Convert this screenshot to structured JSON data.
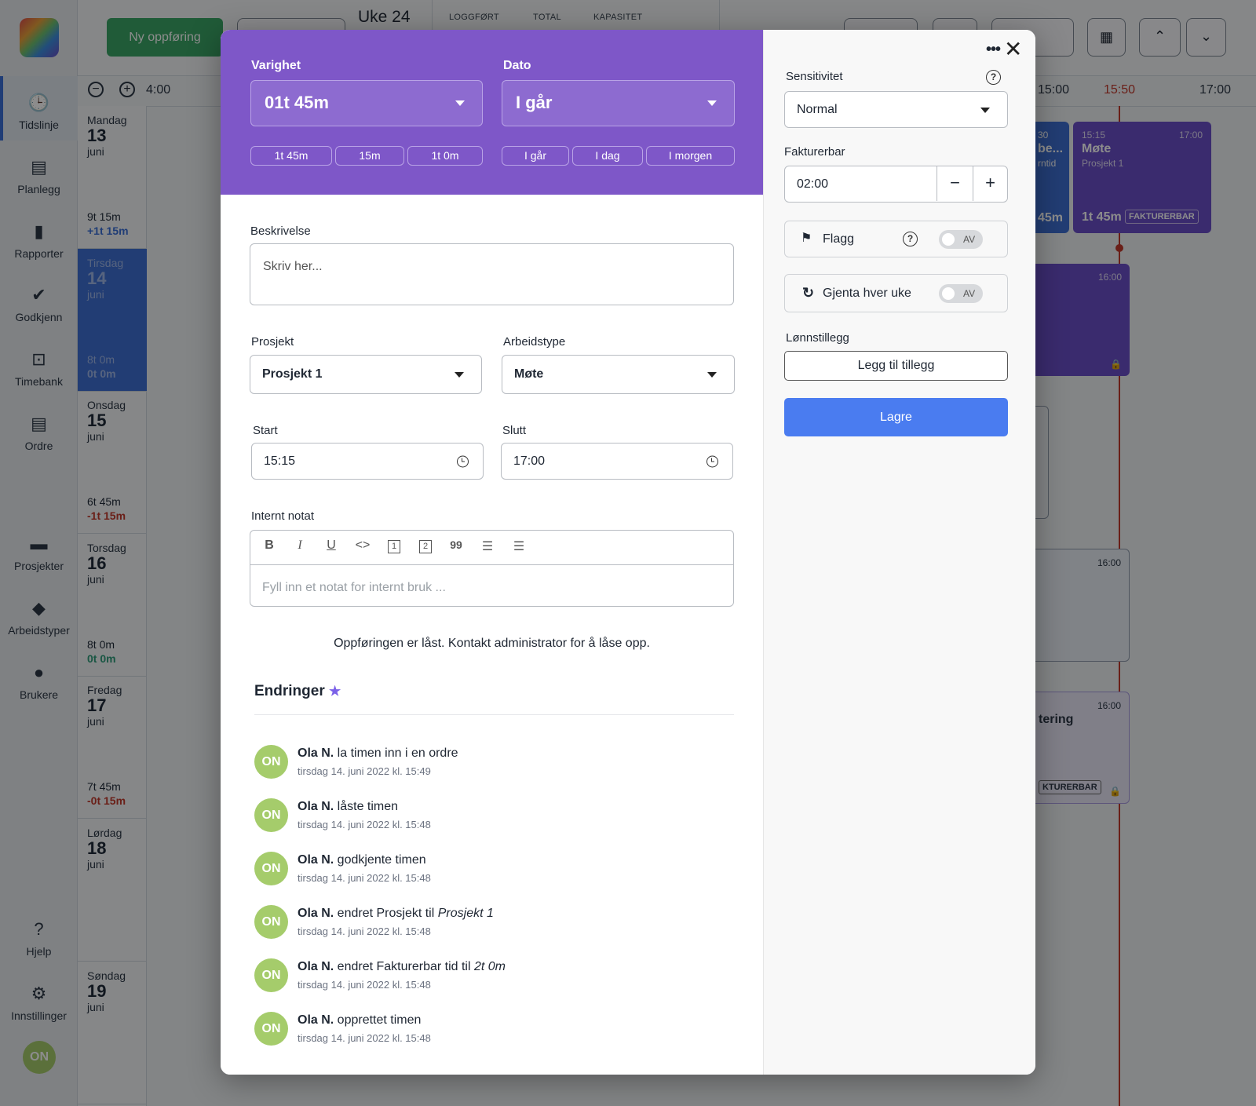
{
  "sidebar": {
    "items": [
      {
        "label": "Tidslinje",
        "icon": "clock-icon"
      },
      {
        "label": "Planlegg",
        "icon": "gantt-icon"
      },
      {
        "label": "Rapporter",
        "icon": "bar-chart-icon"
      },
      {
        "label": "Godkjenn",
        "icon": "check-circle-icon"
      },
      {
        "label": "Timebank",
        "icon": "safe-icon"
      },
      {
        "label": "Ordre",
        "icon": "receipt-icon"
      },
      {
        "label": "Prosjekter",
        "icon": "folder-icon"
      },
      {
        "label": "Arbeidstyper",
        "icon": "tag-icon"
      },
      {
        "label": "Brukere",
        "icon": "user-icon"
      },
      {
        "label": "Hjelp",
        "icon": "help-icon"
      },
      {
        "label": "Innstillinger",
        "icon": "gear-icon"
      }
    ],
    "avatar": "ON"
  },
  "topbar": {
    "new_entry": "Ny oppføring",
    "week": "Uke 24",
    "columns": [
      "LOGGFØRT",
      "TOTAL",
      "KAPASITET"
    ]
  },
  "timeline": {
    "ticks": [
      "4:00",
      "15:00",
      "15:50",
      "17:00"
    ],
    "now_color": "#c0392b"
  },
  "days": [
    {
      "name": "Mandag",
      "date": "13",
      "month": "juni",
      "hours": "9t 15m",
      "diff": "+1t 15m",
      "diff_color": "#3b6fd6"
    },
    {
      "name": "Tirsdag",
      "date": "14",
      "month": "juni",
      "hours": "8t 0m",
      "diff": "0t 0m",
      "diff_color": "#9fb6e6"
    },
    {
      "name": "Onsdag",
      "date": "15",
      "month": "juni",
      "hours": "6t 45m",
      "diff": "-1t 15m",
      "diff_color": "#c0392b"
    },
    {
      "name": "Torsdag",
      "date": "16",
      "month": "juni",
      "hours": "8t 0m",
      "diff": "0t 0m",
      "diff_color": "#2e9c7a"
    },
    {
      "name": "Fredag",
      "date": "17",
      "month": "juni",
      "hours": "7t 45m",
      "diff": "-0t 15m",
      "diff_color": "#c0392b"
    },
    {
      "name": "Lørdag",
      "date": "18",
      "month": "juni",
      "hours": "",
      "diff": ""
    },
    {
      "name": "Søndag",
      "date": "19",
      "month": "juni",
      "hours": "",
      "diff": ""
    }
  ],
  "events": {
    "monday_main": {
      "start": "15:15",
      "end": "17:00",
      "title": "Møte",
      "project": "Prosjekt 1",
      "duration": "1t 45m",
      "badge": "FAKTURERBAR"
    },
    "monday_prev": {
      "start": "30",
      "title": "be...",
      "sub": "rntid",
      "duration": "45m"
    },
    "tuesday": {
      "end": "16:00"
    },
    "thursday": {
      "end": "16:00"
    },
    "friday": {
      "end": "16:00",
      "title": "tering",
      "badge": "KTURERBAR"
    }
  },
  "modal": {
    "duration": {
      "label": "Varighet",
      "value": "01t 45m",
      "chips": [
        "1t 45m",
        "15m",
        "1t 0m"
      ]
    },
    "date": {
      "label": "Dato",
      "value": "I går",
      "chips": [
        "I går",
        "I dag",
        "I morgen"
      ]
    },
    "description": {
      "label": "Beskrivelse",
      "placeholder": "Skriv her..."
    },
    "project": {
      "label": "Prosjekt",
      "value": "Prosjekt 1"
    },
    "worktype": {
      "label": "Arbeidstype",
      "value": "Møte"
    },
    "start": {
      "label": "Start",
      "value": "15:15"
    },
    "end": {
      "label": "Slutt",
      "value": "17:00"
    },
    "note": {
      "label": "Internt notat",
      "placeholder": "Fyll inn et notat for internt bruk ...",
      "toolbar": [
        "B",
        "I",
        "U",
        "<>",
        "1",
        "2",
        "99",
        "ol",
        "ul"
      ]
    },
    "locked_message": "Oppføringen er låst. Kontakt administrator for å låse opp.",
    "changes": {
      "title": "Endringer",
      "items": [
        {
          "initials": "ON",
          "user": "Ola N.",
          "action": " la timen inn i en ordre",
          "emph": "",
          "time": "tirsdag 14. juni 2022 kl. 15:49"
        },
        {
          "initials": "ON",
          "user": "Ola N.",
          "action": " låste timen",
          "emph": "",
          "time": "tirsdag 14. juni 2022 kl. 15:48"
        },
        {
          "initials": "ON",
          "user": "Ola N.",
          "action": " godkjente timen",
          "emph": "",
          "time": "tirsdag 14. juni 2022 kl. 15:48"
        },
        {
          "initials": "ON",
          "user": "Ola N.",
          "action": " endret Prosjekt til ",
          "emph": "Prosjekt 1",
          "time": "tirsdag 14. juni 2022 kl. 15:48"
        },
        {
          "initials": "ON",
          "user": "Ola N.",
          "action": " endret Fakturerbar tid til ",
          "emph": "2t 0m",
          "time": "tirsdag 14. juni 2022 kl. 15:48"
        },
        {
          "initials": "ON",
          "user": "Ola N.",
          "action": " opprettet timen",
          "emph": "",
          "time": "tirsdag 14. juni 2022 kl. 15:48"
        }
      ]
    },
    "sensitivity": {
      "label": "Sensitivitet",
      "value": "Normal"
    },
    "billable": {
      "label": "Fakturerbar",
      "value": "02:00"
    },
    "flag": {
      "label": "Flagg",
      "state": "AV"
    },
    "repeat": {
      "label": "Gjenta hver uke",
      "state": "AV"
    },
    "wage": {
      "label": "Lønnstillegg",
      "button": "Legg til tillegg"
    },
    "save": "Lagre",
    "colors": {
      "header": "#7e57c8",
      "save": "#4a7cf0",
      "avatar": "#a5cc6b",
      "star": "#7b61e8"
    }
  }
}
